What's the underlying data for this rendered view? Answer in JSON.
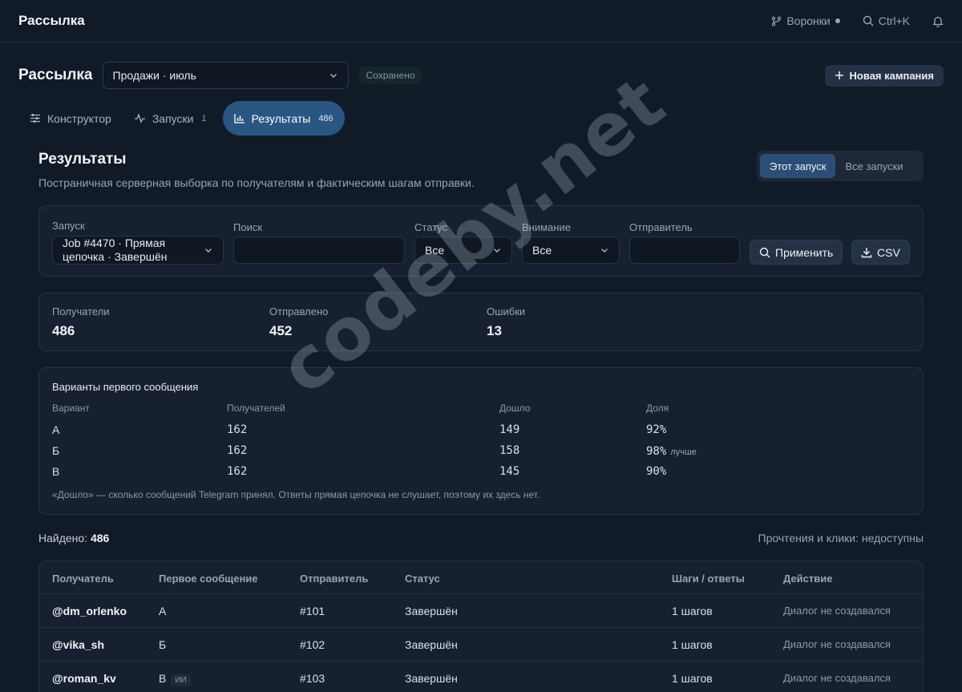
{
  "topbar": {
    "brand": "Рассылка",
    "funnels": "Воронки",
    "shortcut": "Ctrl+K"
  },
  "header": {
    "title": "Рассылка",
    "campaign": "Продажи · июль",
    "saved": "Сохранено",
    "new_campaign": "Новая кампания"
  },
  "tabs": [
    {
      "label": "Конструктор"
    },
    {
      "label": "Запуски",
      "count": "1"
    },
    {
      "label": "Результаты",
      "count": "486"
    }
  ],
  "results": {
    "title": "Результаты",
    "subtitle": "Постраничная серверная выборка по получателям и фактическим шагам отправки.",
    "scope": [
      "Этот запуск",
      "Все запуски"
    ]
  },
  "filters": {
    "run_label": "Запуск",
    "run_value_1": "Job #4470 · Прямая",
    "run_value_2": "цепочка · Завершён",
    "search_label": "Поиск",
    "search_value": "",
    "status_label": "Статус",
    "status_value": "Все",
    "attention_label": "Внимание",
    "attention_value": "Все",
    "sender_label": "Отправитель",
    "sender_value": "",
    "apply": "Применить",
    "csv": "CSV"
  },
  "stats": [
    {
      "label": "Получатели",
      "value": "486"
    },
    {
      "label": "Отправлено",
      "value": "452"
    },
    {
      "label": "Ошибки",
      "value": "13"
    }
  ],
  "variants": {
    "title": "Варианты первого сообщения",
    "headers": [
      "Вариант",
      "Получателей",
      "Дошло",
      "Доля"
    ],
    "rows": [
      {
        "variant": "А",
        "recipients": "162",
        "delivered": "149",
        "share": "92%",
        "tag": ""
      },
      {
        "variant": "Б",
        "recipients": "162",
        "delivered": "158",
        "share": "98%",
        "tag": "лучше"
      },
      {
        "variant": "В",
        "recipients": "162",
        "delivered": "145",
        "share": "90%",
        "tag": ""
      }
    ],
    "note": "«Дошло» — сколько сообщений Telegram принял. Ответы прямая цепочка не слушает, поэтому их здесь нет."
  },
  "found": {
    "label": "Найдено:",
    "value": "486",
    "unavailable": "Прочтения и клики: недоступны"
  },
  "table": {
    "headers": [
      "Получатель",
      "Первое сообщение",
      "Отправитель",
      "Статус",
      "Шаги / ответы",
      "Действие"
    ],
    "rows": [
      {
        "user": "@dm_orlenko",
        "first": "А",
        "badge": "",
        "sender": "#101",
        "status": "Завершён",
        "steps": "1 шагов",
        "action": "Диалог не создавался"
      },
      {
        "user": "@vika_sh",
        "first": "Б",
        "badge": "",
        "sender": "#102",
        "status": "Завершён",
        "steps": "1 шагов",
        "action": "Диалог не создавался"
      },
      {
        "user": "@roman_kv",
        "first": "В",
        "badge": "ИИ",
        "sender": "#103",
        "status": "Завершён",
        "steps": "1 шагов",
        "action": "Диалог не создавался"
      }
    ]
  },
  "watermark": "codeby.net"
}
